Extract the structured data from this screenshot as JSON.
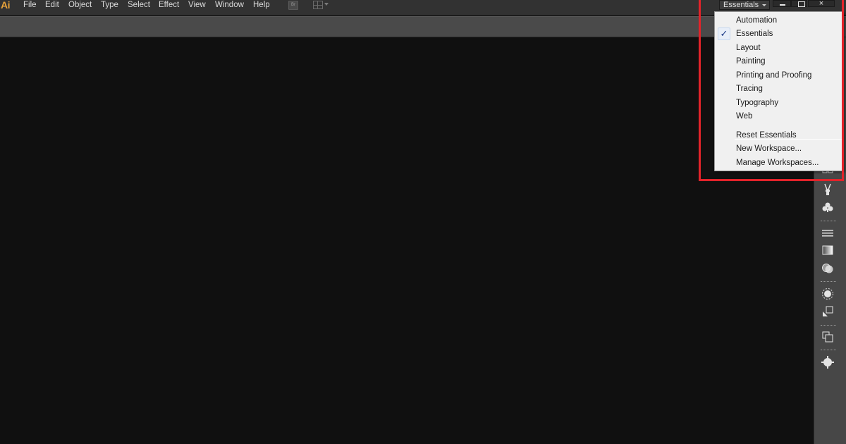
{
  "app": {
    "logo": "Ai"
  },
  "menu": {
    "items": [
      {
        "id": "file",
        "label": "File"
      },
      {
        "id": "edit",
        "label": "Edit"
      },
      {
        "id": "object",
        "label": "Object"
      },
      {
        "id": "type",
        "label": "Type"
      },
      {
        "id": "select",
        "label": "Select"
      },
      {
        "id": "effect",
        "label": "Effect"
      },
      {
        "id": "view",
        "label": "View"
      },
      {
        "id": "window",
        "label": "Window"
      },
      {
        "id": "help",
        "label": "Help"
      }
    ]
  },
  "toolbar": {
    "bridge_label": "Br",
    "arrange_icon": "arrange-documents-icon"
  },
  "workspace": {
    "current": "Essentials",
    "options": [
      {
        "label": "Automation",
        "checked": false
      },
      {
        "label": "Essentials",
        "checked": true
      },
      {
        "label": "Layout",
        "checked": false
      },
      {
        "label": "Painting",
        "checked": false
      },
      {
        "label": "Printing and Proofing",
        "checked": false
      },
      {
        "label": "Tracing",
        "checked": false
      },
      {
        "label": "Typography",
        "checked": false
      },
      {
        "label": "Web",
        "checked": false
      }
    ],
    "actions": [
      {
        "label": "Reset Essentials"
      },
      {
        "label": "New Workspace..."
      },
      {
        "label": "Manage Workspaces..."
      }
    ],
    "check_glyph": "✓"
  },
  "window_controls": {
    "close_glyph": "×"
  },
  "colors": {
    "highlight": "#e3232a",
    "logo": "#e8a33b",
    "check": "#1b3a86"
  },
  "dock": {
    "icons": [
      "libraries-icon",
      "brushes-icon",
      "symbols-icon",
      "stroke-icon",
      "gradient-icon",
      "transparency-icon",
      "appearance-icon",
      "graphic-styles-icon",
      "layers-icon",
      "artboards-icon"
    ]
  }
}
